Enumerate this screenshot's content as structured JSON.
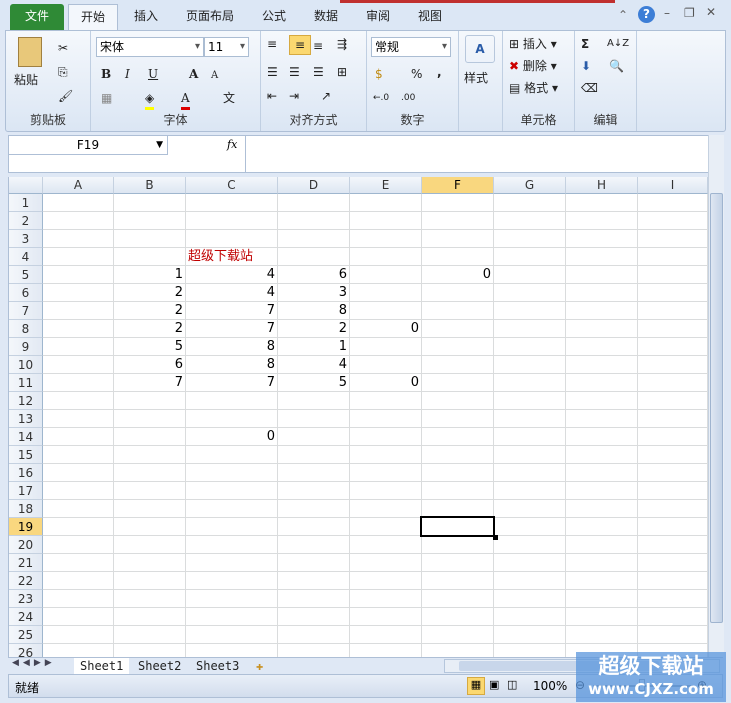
{
  "tabs": [
    "文件",
    "开始",
    "插入",
    "页面布局",
    "公式",
    "数据",
    "审阅",
    "视图"
  ],
  "ribbon": {
    "clipboard": {
      "paste": "粘贴",
      "label": "剪贴板"
    },
    "font": {
      "name": "宋体",
      "size": "11",
      "bold": "B",
      "italic": "I",
      "underline": "U",
      "grow": "A",
      "shrink": "A",
      "color_letter": "A",
      "phonetic": "文",
      "label": "字体"
    },
    "align": {
      "label": "对齐方式"
    },
    "number": {
      "format": "常规",
      "percent": "%",
      "comma": ",",
      "inc": "←.0",
      "dec": ".00",
      "label": "数字"
    },
    "styles": {
      "label": "样式"
    },
    "cells": {
      "insert": "插入",
      "delete": "删除",
      "format": "格式",
      "label": "单元格"
    },
    "editing": {
      "sum": "Σ",
      "sort": "A↓Z",
      "label": "编辑"
    }
  },
  "formula_bar": {
    "name_box": "F19",
    "fx": "fx",
    "value": ""
  },
  "grid": {
    "columns": [
      "A",
      "B",
      "C",
      "D",
      "E",
      "F",
      "G",
      "H",
      "I"
    ],
    "rows": [
      "1",
      "2",
      "3",
      "4",
      "5",
      "6",
      "7",
      "8",
      "9",
      "10",
      "11",
      "12",
      "13",
      "14",
      "15",
      "16",
      "17",
      "18",
      "19",
      "20",
      "21",
      "22",
      "23",
      "24",
      "25",
      "26"
    ],
    "selected_cell": "F19",
    "title_cell": {
      "ref": "C4",
      "text": "超级下载站",
      "color": "#c00000"
    },
    "cells": [
      {
        "ref": "B5",
        "v": "1"
      },
      {
        "ref": "C5",
        "v": "4"
      },
      {
        "ref": "D5",
        "v": "6"
      },
      {
        "ref": "F5",
        "v": "0"
      },
      {
        "ref": "B6",
        "v": "2"
      },
      {
        "ref": "C6",
        "v": "4"
      },
      {
        "ref": "D6",
        "v": "3"
      },
      {
        "ref": "B7",
        "v": "2"
      },
      {
        "ref": "C7",
        "v": "7"
      },
      {
        "ref": "D7",
        "v": "8"
      },
      {
        "ref": "B8",
        "v": "2"
      },
      {
        "ref": "C8",
        "v": "7"
      },
      {
        "ref": "D8",
        "v": "2"
      },
      {
        "ref": "E8",
        "v": "0"
      },
      {
        "ref": "B9",
        "v": "5"
      },
      {
        "ref": "C9",
        "v": "8"
      },
      {
        "ref": "D9",
        "v": "1"
      },
      {
        "ref": "B10",
        "v": "6"
      },
      {
        "ref": "C10",
        "v": "8"
      },
      {
        "ref": "D10",
        "v": "4"
      },
      {
        "ref": "B11",
        "v": "7"
      },
      {
        "ref": "C11",
        "v": "7"
      },
      {
        "ref": "D11",
        "v": "5"
      },
      {
        "ref": "E11",
        "v": "0"
      },
      {
        "ref": "C14",
        "v": "0"
      }
    ]
  },
  "sheets": [
    "Sheet1",
    "Sheet2",
    "Sheet3"
  ],
  "status": {
    "ready": "就绪",
    "zoom": "100%"
  },
  "watermark": {
    "title": "超级下载站",
    "url": "www.CJXZ.com"
  }
}
